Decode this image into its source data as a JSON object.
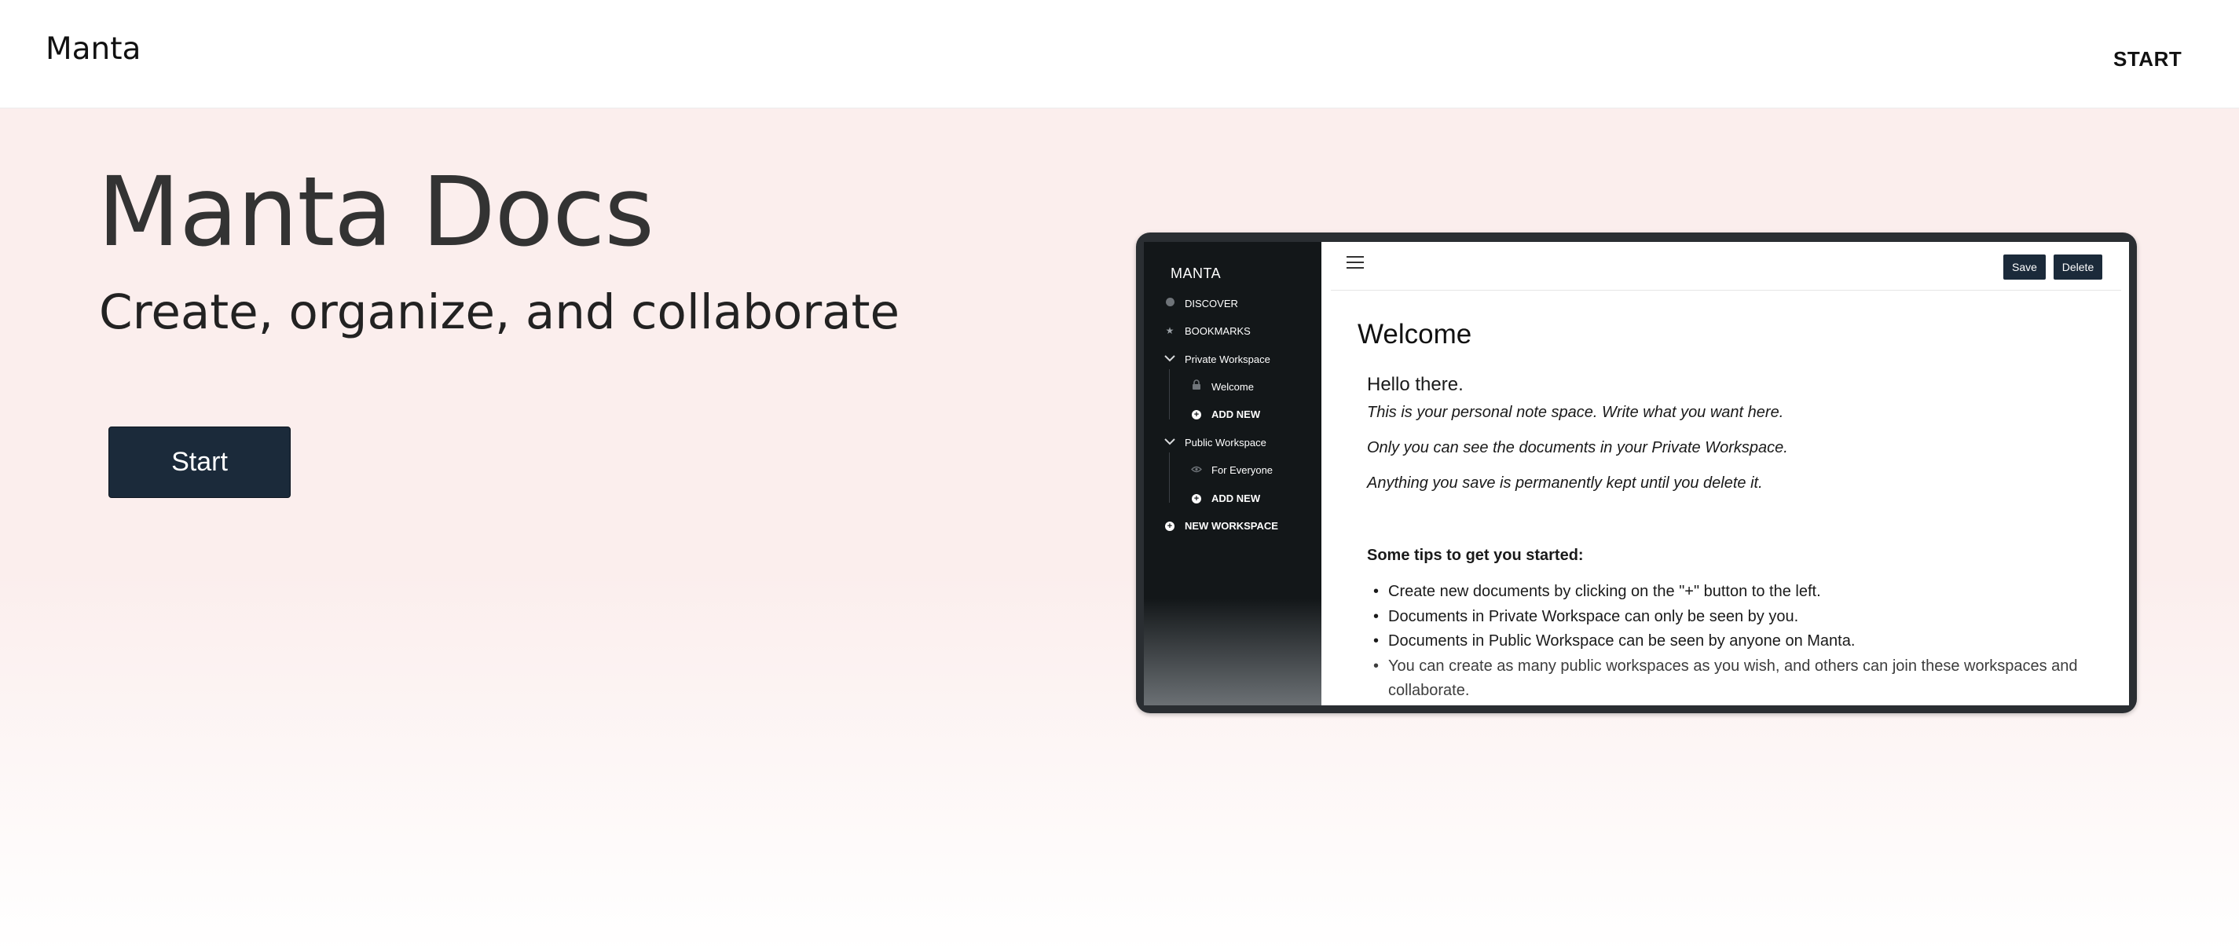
{
  "nav": {
    "brand": "Manta",
    "start_label": "START"
  },
  "hero": {
    "title": "Manta Docs",
    "subtitle": "Create, organize, and collaborate",
    "cta_label": "Start"
  },
  "preview": {
    "sidebar": {
      "brand": "MANTA",
      "discover": "DISCOVER",
      "bookmarks": "BOOKMARKS",
      "private_workspace": "Private Workspace",
      "private_doc": "Welcome",
      "private_add": "ADD NEW",
      "public_workspace": "Public Workspace",
      "public_doc": "For Everyone",
      "public_add": "ADD NEW",
      "new_workspace": "NEW WORKSPACE"
    },
    "toolbar": {
      "save_label": "Save",
      "delete_label": "Delete"
    },
    "document": {
      "title": "Welcome",
      "greeting": "Hello there.",
      "lines": [
        "This is your personal note space. Write what you want here.",
        "Only you can see the documents in your Private Workspace.",
        "Anything you save is permanently kept until you delete it."
      ],
      "tips_heading": "Some tips to get you started:",
      "tips": [
        "Create new documents by clicking on the \"+\" button to the left.",
        "Documents in Private Workspace can only be seen by you.",
        "Documents in Public Workspace can be seen by anyone on Manta.",
        "You can create as many public workspaces as you wish, and others can join these workspaces and collaborate."
      ]
    }
  },
  "colors": {
    "hero_background": "#fbeeed",
    "primary_button": "#1b2a3a",
    "sidebar_background": "#131719"
  }
}
